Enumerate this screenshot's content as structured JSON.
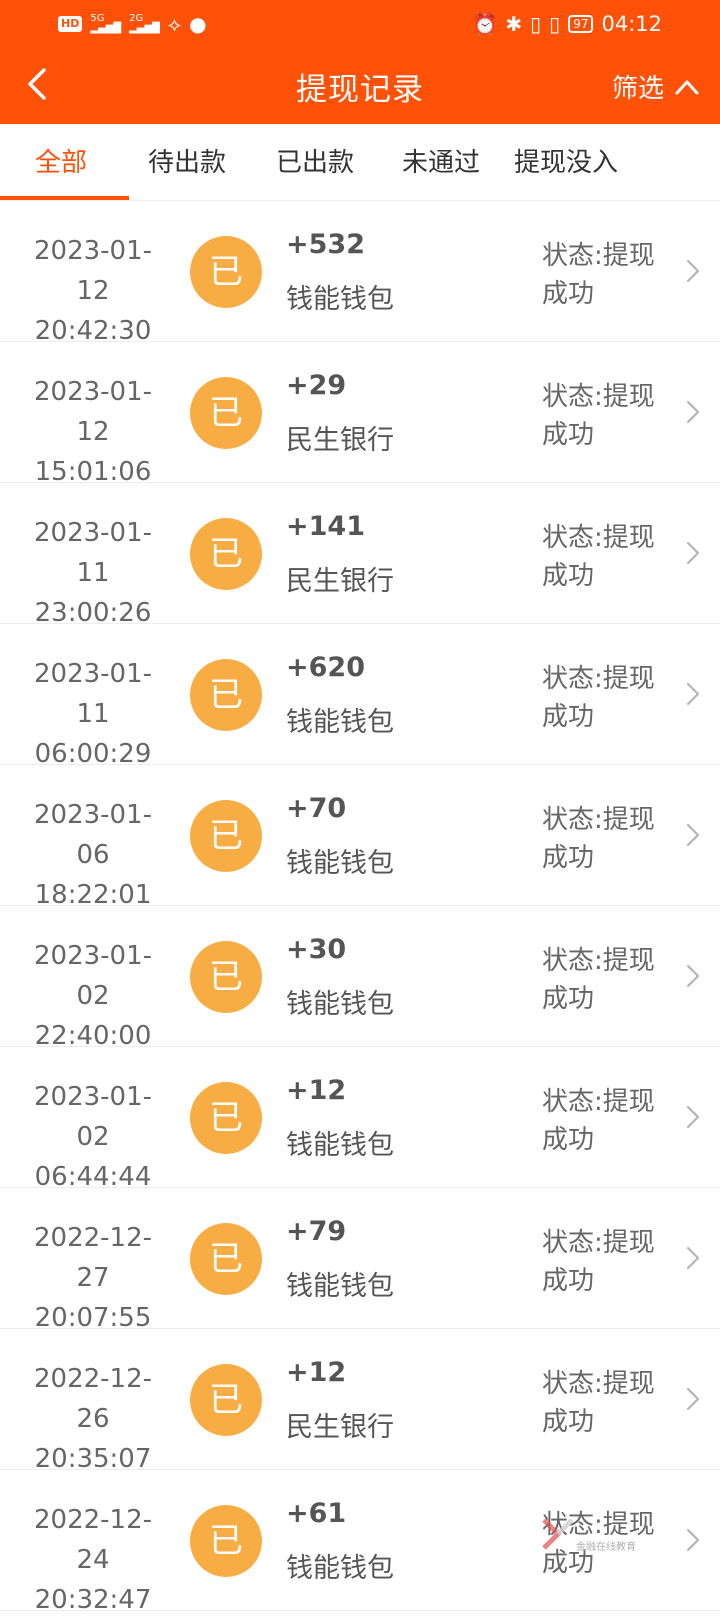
{
  "status_bar": {
    "left_badges": [
      "HD",
      "5G",
      "2G"
    ],
    "battery": "97",
    "time": "04:12"
  },
  "header": {
    "title": "提现记录",
    "filter_label": "筛选",
    "back_icon": "chevron-left-icon",
    "filter_icon": "chevron-up-icon"
  },
  "tabs": [
    {
      "label": "全部",
      "active": true
    },
    {
      "label": "待出款",
      "active": false
    },
    {
      "label": "已出款",
      "active": false
    },
    {
      "label": "未通过",
      "active": false
    },
    {
      "label": "提现没入",
      "active": false
    }
  ],
  "records": [
    {
      "date": "2023-01-12",
      "time": "20:42:30",
      "badge": "已",
      "amount": "+532",
      "bank": "钱能钱包",
      "status_line1": "状态:提现",
      "status_line2": "成功"
    },
    {
      "date": "2023-01-12",
      "time": "15:01:06",
      "badge": "已",
      "amount": "+29",
      "bank": "民生银行",
      "status_line1": "状态:提现",
      "status_line2": "成功"
    },
    {
      "date": "2023-01-11",
      "time": "23:00:26",
      "badge": "已",
      "amount": "+141",
      "bank": "民生银行",
      "status_line1": "状态:提现",
      "status_line2": "成功"
    },
    {
      "date": "2023-01-11",
      "time": "06:00:29",
      "badge": "已",
      "amount": "+620",
      "bank": "钱能钱包",
      "status_line1": "状态:提现",
      "status_line2": "成功"
    },
    {
      "date": "2023-01-06",
      "time": "18:22:01",
      "badge": "已",
      "amount": "+70",
      "bank": "钱能钱包",
      "status_line1": "状态:提现",
      "status_line2": "成功"
    },
    {
      "date": "2023-01-02",
      "time": "22:40:00",
      "badge": "已",
      "amount": "+30",
      "bank": "钱能钱包",
      "status_line1": "状态:提现",
      "status_line2": "成功"
    },
    {
      "date": "2023-01-02",
      "time": "06:44:44",
      "badge": "已",
      "amount": "+12",
      "bank": "钱能钱包",
      "status_line1": "状态:提现",
      "status_line2": "成功"
    },
    {
      "date": "2022-12-27",
      "time": "20:07:55",
      "badge": "已",
      "amount": "+79",
      "bank": "钱能钱包",
      "status_line1": "状态:提现",
      "status_line2": "成功"
    },
    {
      "date": "2022-12-26",
      "time": "20:35:07",
      "badge": "已",
      "amount": "+12",
      "bank": "民生银行",
      "status_line1": "状态:提现",
      "status_line2": "成功"
    },
    {
      "date": "2022-12-24",
      "time": "20:32:47",
      "badge": "已",
      "amount": "+61",
      "bank": "钱能钱包",
      "status_line1": "状态:提现",
      "status_line2": "成功"
    }
  ],
  "watermark": {
    "text": "金融在线教育"
  },
  "colors": {
    "brand": "#ff5208",
    "badge": "#f7ad44"
  }
}
